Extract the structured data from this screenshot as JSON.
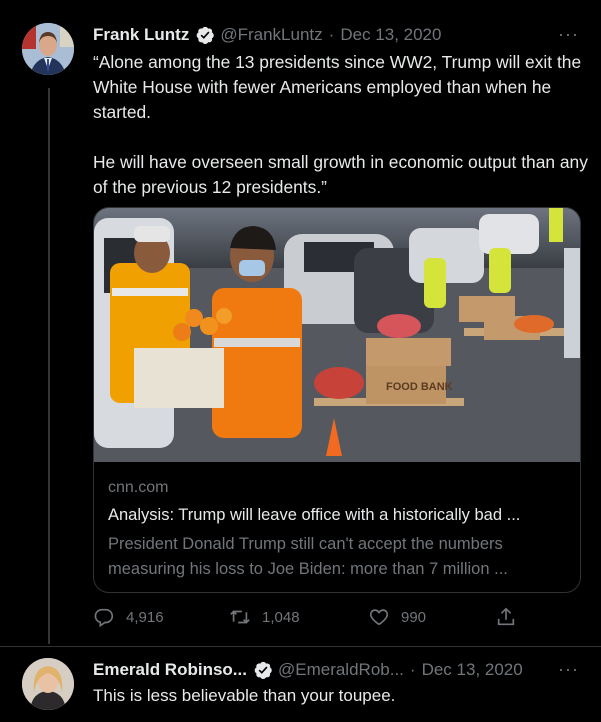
{
  "tweet": {
    "author_name": "Frank Luntz",
    "handle": "@FrankLuntz",
    "separator": "·",
    "date": "Dec 13, 2020",
    "more": "···",
    "paragraphs": [
      "“Alone among the 13 presidents since WW2, Trump will exit the White House with fewer Americans employed than when he started.",
      "He will have overseen small growth in economic output than any of the previous 12 presidents.”"
    ],
    "card": {
      "domain": "cnn.com",
      "title": "Analysis: Trump will leave office with a historically bad ...",
      "description": "President Donald Trump still can't accept the numbers measuring his loss to Joe Biden: more than 7 million ...",
      "image_box_text": "FOOD BANK"
    },
    "actions": {
      "replies": "4,916",
      "retweets": "1,048",
      "likes": "990"
    }
  },
  "reply": {
    "author_name": "Emerald Robinso...",
    "handle": "@EmeraldRob...",
    "separator": "·",
    "date": "Dec 13, 2020",
    "more": "···",
    "text": "This is less believable than your toupee."
  },
  "colors": {
    "background": "#000000",
    "text_primary": "#e7e9ea",
    "text_secondary": "#71767b",
    "verified": "#1d9bf0",
    "border": "#2f3336"
  },
  "icons": [
    "verified-badge-icon",
    "more-icon",
    "reply-icon",
    "retweet-icon",
    "like-icon",
    "share-icon"
  ]
}
